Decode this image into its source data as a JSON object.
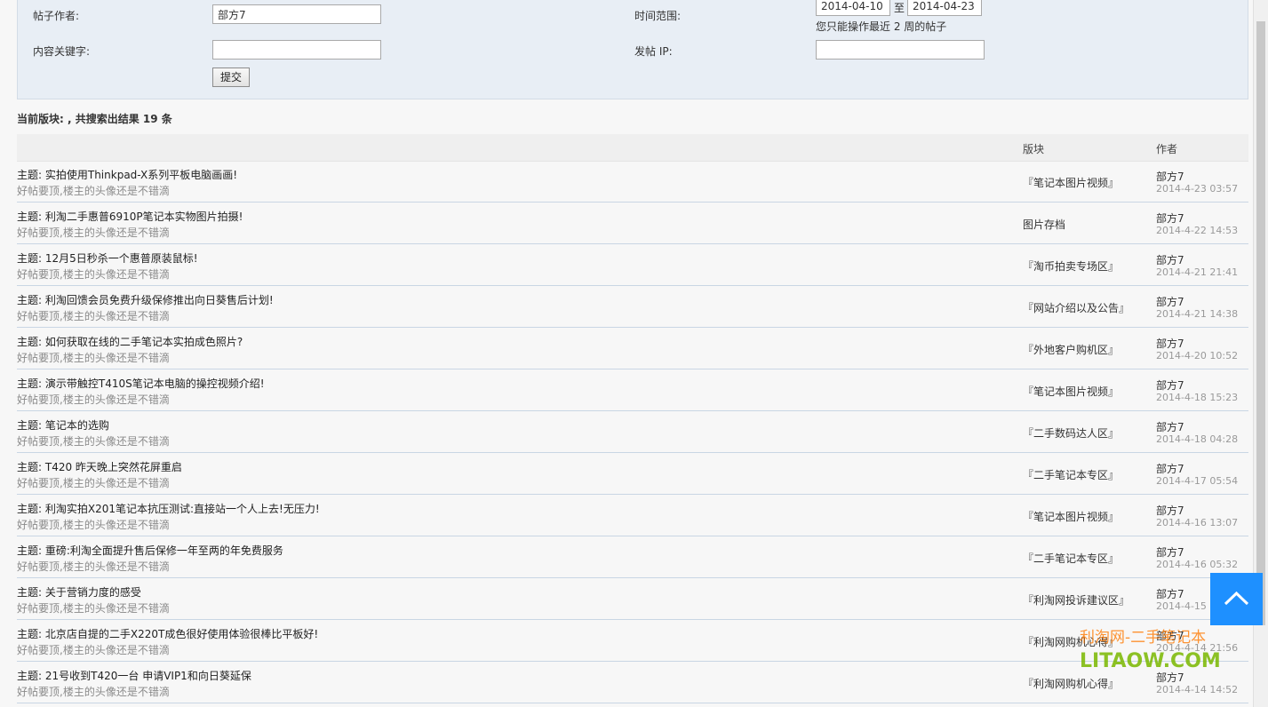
{
  "search": {
    "author_label": "帖子作者:",
    "author_value": "部方7",
    "keyword_label": "内容关键字:",
    "keyword_value": "",
    "submit_label": "提交",
    "time_label": "时间范围:",
    "date_from": "2014-04-10",
    "date_sep": "至",
    "date_to": "2014-04-23",
    "time_hint": "您只能操作最近 2 周的帖子",
    "ip_label": "发帖 IP:",
    "ip_value": ""
  },
  "summary": "当前版块: , 共搜索出结果 19 条",
  "table": {
    "col_board": "版块",
    "col_author": "作者",
    "rows": [
      {
        "subject_prefix": "主题:",
        "subject": "实拍使用Thinkpad-X系列平板电脑画画!",
        "sig": "好帖要顶,楼主的头像还是不错滴",
        "board": "『笔记本图片视频』",
        "author": "部方7",
        "date": "2014-4-23 03:57"
      },
      {
        "subject_prefix": "主题:",
        "subject": "利淘二手惠普6910P笔记本实物图片拍摄!",
        "sig": "好帖要顶,楼主的头像还是不错滴",
        "board": "图片存档",
        "author": "部方7",
        "date": "2014-4-22 14:53"
      },
      {
        "subject_prefix": "主题:",
        "subject": "12月5日秒杀一个惠普原装鼠标!",
        "sig": "好帖要顶,楼主的头像还是不错滴",
        "board": "『淘币拍卖专场区』",
        "author": "部方7",
        "date": "2014-4-21 21:41"
      },
      {
        "subject_prefix": "主题:",
        "subject": "利淘回馈会员免费升级保修推出向日葵售后计划!",
        "sig": "好帖要顶,楼主的头像还是不错滴",
        "board": "『网站介绍以及公告』",
        "author": "部方7",
        "date": "2014-4-21 14:38"
      },
      {
        "subject_prefix": "主题:",
        "subject": "如何获取在线的二手笔记本实拍成色照片?",
        "sig": "好帖要顶,楼主的头像还是不错滴",
        "board": "『外地客户购机区』",
        "author": "部方7",
        "date": "2014-4-20 10:52"
      },
      {
        "subject_prefix": "主题:",
        "subject": "演示带触控T410S笔记本电脑的操控视频介绍!",
        "sig": "好帖要顶,楼主的头像还是不错滴",
        "board": "『笔记本图片视频』",
        "author": "部方7",
        "date": "2014-4-18 15:23"
      },
      {
        "subject_prefix": "主题:",
        "subject": "笔记本的选购",
        "sig": "好帖要顶,楼主的头像还是不错滴",
        "board": "『二手数码达人区』",
        "author": "部方7",
        "date": "2014-4-18 04:28"
      },
      {
        "subject_prefix": "主题:",
        "subject": "T420 昨天晚上突然花屏重启",
        "sig": "好帖要顶,楼主的头像还是不错滴",
        "board": "『二手笔记本专区』",
        "author": "部方7",
        "date": "2014-4-17 05:54"
      },
      {
        "subject_prefix": "主题:",
        "subject": "利淘实拍X201笔记本抗压测试:直接站一个人上去!无压力!",
        "sig": "好帖要顶,楼主的头像还是不错滴",
        "board": "『笔记本图片视频』",
        "author": "部方7",
        "date": "2014-4-16 13:07"
      },
      {
        "subject_prefix": "主题:",
        "subject": "重磅:利淘全面提升售后保修一年至两的年免费服务",
        "sig": "好帖要顶,楼主的头像还是不错滴",
        "board": "『二手笔记本专区』",
        "author": "部方7",
        "date": "2014-4-16 05:32"
      },
      {
        "subject_prefix": "主题:",
        "subject": "关于营销力度的感受",
        "sig": "好帖要顶,楼主的头像还是不错滴",
        "board": "『利淘网投诉建议区』",
        "author": "部方7",
        "date": "2014-4-15 07"
      },
      {
        "subject_prefix": "主题:",
        "subject": "北京店自提的二手X220T成色很好使用体验很棒比平板好!",
        "sig": "好帖要顶,楼主的头像还是不错滴",
        "board": "『利淘网购机心得』",
        "author": "部方7",
        "date": "2014-4-14 21:56"
      },
      {
        "subject_prefix": "主题:",
        "subject": "21号收到T420一台 申请VIP1和向日葵延保",
        "sig": "好帖要顶,楼主的头像还是不错滴",
        "board": "『利淘网购机心得』",
        "author": "部方7",
        "date": "2014-4-14 14:52"
      }
    ]
  },
  "back_to_top_icon": "chevron-up-icon",
  "watermark": {
    "cn": "利淘网-二手笔记本",
    "en": "LITAOW.COM"
  },
  "colors": {
    "accent": "#1e90ff",
    "panel_bg": "#e8eef5",
    "row_border": "#c9d6e4",
    "signature": "#8a8a8a"
  }
}
